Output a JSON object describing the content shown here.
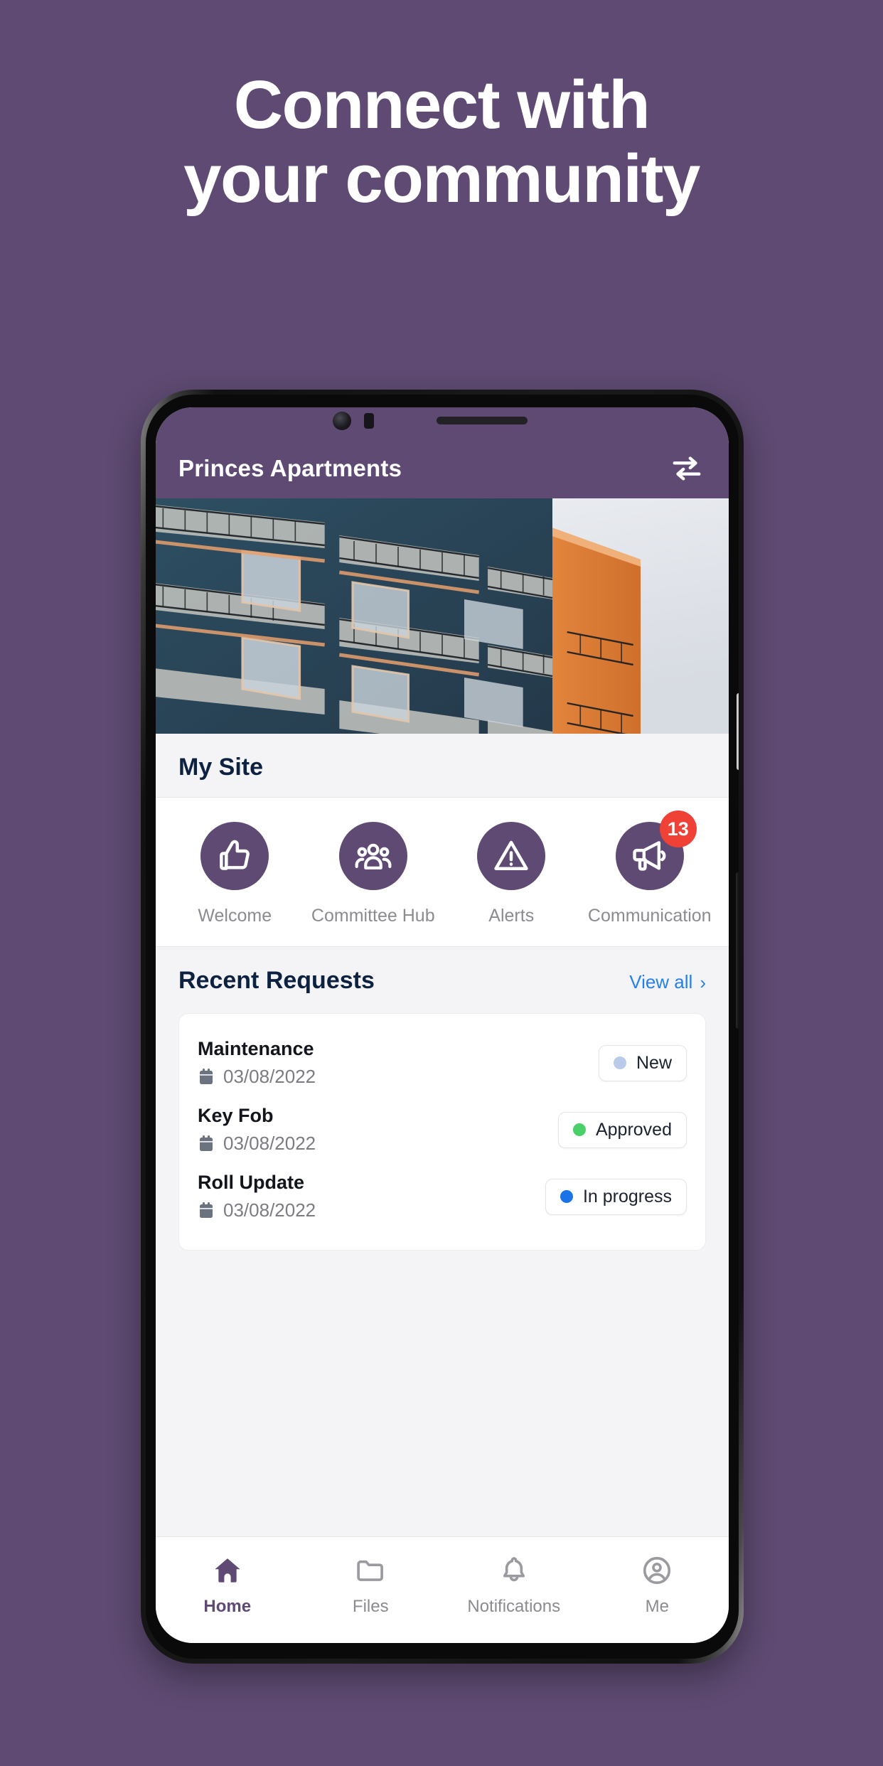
{
  "promo": {
    "headline_line1": "Connect with",
    "headline_line2": "your community",
    "background_color": "#5e4a72",
    "headline_color": "#ffffff"
  },
  "app": {
    "brand_color": "#5e4a72",
    "header": {
      "site_name": "Princes Apartments",
      "switch_icon": "swap-arrows-icon"
    },
    "hero": {
      "image_alt": "apartment-building-photo"
    },
    "my_site": {
      "title": "My Site",
      "shortcuts": [
        {
          "label": "Welcome",
          "icon": "thumbs-up-icon",
          "badge": null
        },
        {
          "label": "Committee Hub",
          "icon": "people-group-icon",
          "badge": null
        },
        {
          "label": "Alerts",
          "icon": "warning-triangle-icon",
          "badge": null
        },
        {
          "label": "Communication",
          "icon": "megaphone-icon",
          "badge": "13"
        }
      ]
    },
    "recent_requests": {
      "title": "Recent Requests",
      "view_all_label": "View all",
      "view_all_chevron": "›",
      "rows": [
        {
          "title": "Maintenance",
          "date": "03/08/2022",
          "date_icon": "calendar-icon",
          "status": "New",
          "status_color": "#b9cbe8"
        },
        {
          "title": "Key Fob",
          "date": "03/08/2022",
          "date_icon": "calendar-icon",
          "status": "Approved",
          "status_color": "#4ad06a"
        },
        {
          "title": "Roll Update",
          "date": "03/08/2022",
          "date_icon": "calendar-icon",
          "status": "In progress",
          "status_color": "#1a74e8"
        }
      ]
    },
    "bottom_nav": {
      "items": [
        {
          "label": "Home",
          "icon": "home-icon",
          "active": true
        },
        {
          "label": "Files",
          "icon": "folder-icon",
          "active": false
        },
        {
          "label": "Notifications",
          "icon": "bell-icon",
          "active": false
        },
        {
          "label": "Me",
          "icon": "user-circle-icon",
          "active": false
        }
      ]
    }
  }
}
